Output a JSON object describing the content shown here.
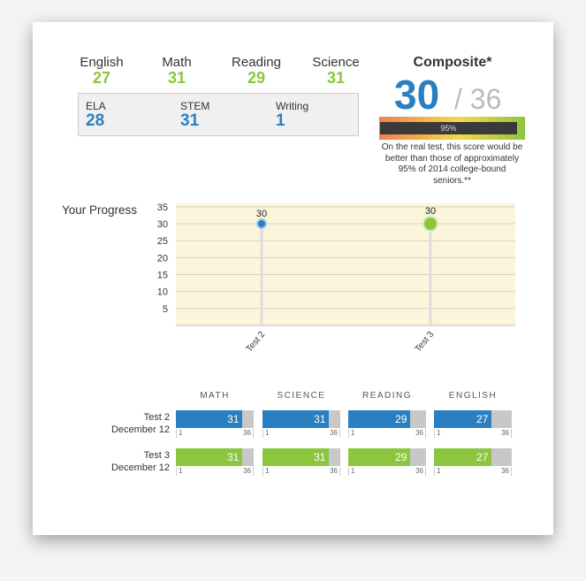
{
  "scores": [
    {
      "label": "English",
      "value": "27"
    },
    {
      "label": "Math",
      "value": "31"
    },
    {
      "label": "Reading",
      "value": "29"
    },
    {
      "label": "Science",
      "value": "31"
    }
  ],
  "combined": [
    {
      "label": "ELA",
      "value": "28"
    },
    {
      "label": "STEM",
      "value": "31"
    },
    {
      "label": "Writing",
      "value": "1"
    }
  ],
  "composite": {
    "title": "Composite*",
    "score": "30",
    "max": "/ 36",
    "percentile_label": "95%",
    "percentile": 95,
    "note": "On the real test, this score would be better than those of approximately 95% of 2014 college-bound seniors.**"
  },
  "progress": {
    "title": "Your Progress"
  },
  "chart_data": {
    "type": "scatter",
    "title": "Your Progress",
    "x": [
      "Test 2",
      "Test 3"
    ],
    "y": [
      30,
      30
    ],
    "data_labels": [
      "30",
      "30"
    ],
    "yticks": [
      5,
      10,
      15,
      20,
      25,
      30,
      35
    ],
    "ylim": [
      0,
      36
    ],
    "grid": true,
    "colors": [
      "#2a7fc1",
      "#8cc63f"
    ]
  },
  "breakdown": {
    "headers": [
      "MATH",
      "SCIENCE",
      "READING",
      "ENGLISH"
    ],
    "min": "1",
    "max": "36",
    "rows": [
      {
        "test": "Test 2",
        "date": "December 12",
        "color": "#2a7fc1",
        "values": [
          "31",
          "31",
          "29",
          "27"
        ]
      },
      {
        "test": "Test 3",
        "date": "December 12",
        "color": "#8cc63f",
        "values": [
          "31",
          "31",
          "29",
          "27"
        ]
      }
    ]
  }
}
